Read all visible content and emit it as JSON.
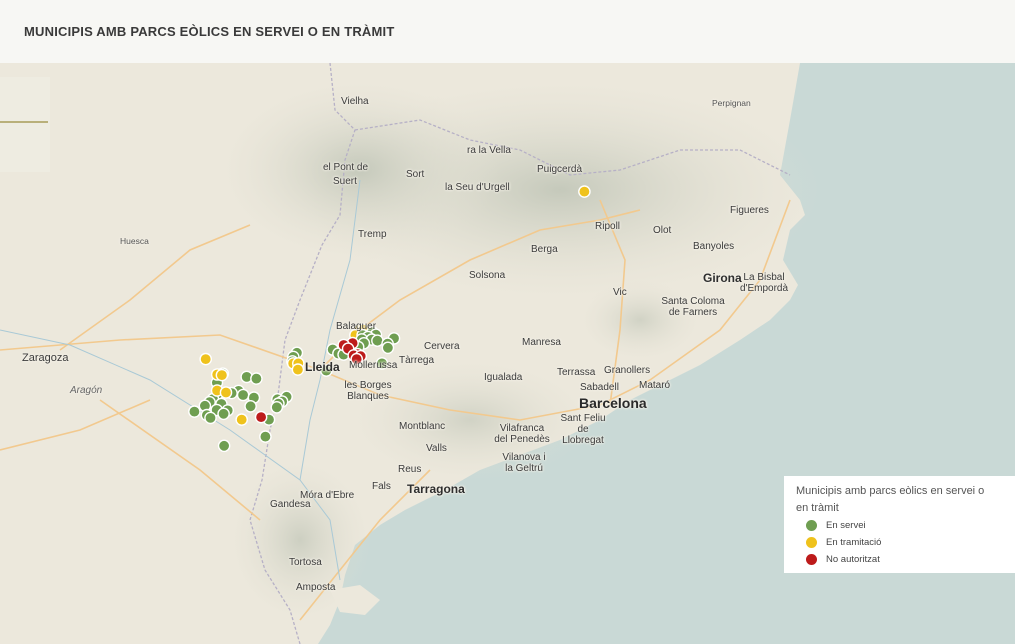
{
  "header": {
    "title": "MUNICIPIS AMB PARCS EÒLICS EN SERVEI O EN TRÀMIT"
  },
  "colors": {
    "sea": "#c9d9d6",
    "land": "#ece8dc",
    "mountains": "#d8d8cb",
    "mountains_high": "#c8cbbd",
    "in_service": "#6f9e51",
    "in_process": "#efc21c",
    "not_authorized": "#bd1b1b",
    "road": "#f2c98e",
    "border": "#b6b0c6"
  },
  "legend": {
    "title": "Municipis amb parcs eòlics en servei o en tràmit",
    "items": [
      {
        "label": "En servei",
        "color": "#6f9e51"
      },
      {
        "label": "En tramitació",
        "color": "#efc21c"
      },
      {
        "label": "No autoritzat",
        "color": "#bd1b1b"
      }
    ]
  },
  "places": {
    "vielha": "Vielha",
    "perpignan": "Perpignan",
    "vall": "ra la Vella",
    "pont_de": "el Pont de",
    "suert": "Suert",
    "sort": "Sort",
    "seu": "la Seu d'Urgell",
    "puigcerda": "Puigcerdà",
    "figueres": "Figueres",
    "huesca": "Huesca",
    "tremp": "Tremp",
    "ripoll": "Ripoll",
    "olot": "Olot",
    "banyoles": "Banyoles",
    "berga": "Berga",
    "solsona": "Solsona",
    "girona": "Girona",
    "bisbal": "La Bisbal d'Empordà",
    "vic": "Vic",
    "santa_coloma": "Santa Coloma de Farners",
    "balaguer": "Balaguer",
    "cervera": "Cervera",
    "manresa": "Manresa",
    "zaragoza": "Zaragoza",
    "lleida": "Lleida",
    "mollerussa": "Mollerussa",
    "tarrega": "Tàrrega",
    "igualada": "Igualada",
    "terrassa": "Terrassa",
    "granollers": "Granollers",
    "borges": "les Borges Blanques",
    "sabadell": "Sabadell",
    "mataro": "Mataró",
    "aragon": "Aragón",
    "barcelona": "Barcelona",
    "montblanc": "Montblanc",
    "sant_feliu": "Sant Feliu de Llobregat",
    "vilafranca": "Vilafranca del Penedès",
    "valls": "Valls",
    "vilanova": "Vilanova i la Geltrú",
    "reus": "Reus",
    "tarragona": "Tarragona",
    "falset": "Fals",
    "mora": "Móra d'Ebre",
    "gandesa": "Gandesa",
    "tortosa": "Tortosa",
    "amposta": "Amposta"
  },
  "markers": [
    {
      "status": "in_process",
      "lon": 2.74,
      "lat": 42.37
    },
    {
      "status": "in_process",
      "lon": 1.294,
      "lat": 41.695
    },
    {
      "status": "in_process",
      "lon": 1.322,
      "lat": 41.697
    },
    {
      "status": "in_process",
      "lon": 1.272,
      "lat": 41.67
    },
    {
      "status": "in_service",
      "lon": 1.381,
      "lat": 41.684
    },
    {
      "status": "in_service",
      "lon": 1.318,
      "lat": 41.67
    },
    {
      "status": "in_service",
      "lon": 1.403,
      "lat": 41.672
    },
    {
      "status": "in_service",
      "lon": 1.353,
      "lat": 41.661
    },
    {
      "status": "in_service",
      "lon": 1.313,
      "lat": 41.649
    },
    {
      "status": "in_service",
      "lon": 1.377,
      "lat": 41.648
    },
    {
      "status": "in_service",
      "lon": 1.413,
      "lat": 41.643
    },
    {
      "status": "in_service",
      "lon": 1.519,
      "lat": 41.654
    },
    {
      "status": "in_service",
      "lon": 1.478,
      "lat": 41.628
    },
    {
      "status": "in_service",
      "lon": 1.326,
      "lat": 41.63
    },
    {
      "status": "in_service",
      "lon": 1.29,
      "lat": 41.612
    },
    {
      "status": "in_service",
      "lon": 1.48,
      "lat": 41.608
    },
    {
      "status": "in_service",
      "lon": 1.234,
      "lat": 41.601
    },
    {
      "status": "in_service",
      "lon": 1.186,
      "lat": 41.599
    },
    {
      "status": "in_service",
      "lon": 1.126,
      "lat": 41.6
    },
    {
      "status": "in_service",
      "lon": 1.208,
      "lat": 41.587
    },
    {
      "status": "in_service",
      "lon": 1.163,
      "lat": 41.58
    },
    {
      "status": "in_service",
      "lon": 1.196,
      "lat": 41.575
    },
    {
      "status": "in_service",
      "lon": 0.897,
      "lat": 41.584
    },
    {
      "status": "in_service",
      "lon": 0.874,
      "lat": 41.564
    },
    {
      "status": "in_service",
      "lon": 0.868,
      "lat": 41.542
    },
    {
      "status": "in_service",
      "lon": 1.442,
      "lat": 41.532
    },
    {
      "status": "in_service",
      "lon": 1.085,
      "lat": 41.497
    },
    {
      "status": "in_service",
      "lon": 0.422,
      "lat": 41.482
    },
    {
      "status": "in_service",
      "lon": 0.575,
      "lat": 41.466
    },
    {
      "status": "in_service",
      "lon": 0.637,
      "lat": 41.458
    },
    {
      "status": "in_service",
      "lon": 0.384,
      "lat": 41.438
    },
    {
      "status": "in_service",
      "lon": 0.523,
      "lat": 41.398
    },
    {
      "status": "in_service",
      "lon": 0.478,
      "lat": 41.387
    },
    {
      "status": "in_service",
      "lon": 0.393,
      "lat": 41.386
    },
    {
      "status": "in_service",
      "lon": 0.831,
      "lat": 41.369
    },
    {
      "status": "in_service",
      "lon": 0.552,
      "lat": 41.378
    },
    {
      "status": "in_service",
      "lon": 0.621,
      "lat": 41.365
    },
    {
      "status": "in_service",
      "lon": 0.359,
      "lat": 41.358
    },
    {
      "status": "in_service",
      "lon": 0.772,
      "lat": 41.357
    },
    {
      "status": "in_service",
      "lon": 0.802,
      "lat": 41.346
    },
    {
      "status": "in_service",
      "lon": 0.337,
      "lat": 41.343
    },
    {
      "status": "in_service",
      "lon": 0.778,
      "lat": 41.336
    },
    {
      "status": "in_service",
      "lon": 0.413,
      "lat": 41.334
    },
    {
      "status": "in_service",
      "lon": 0.768,
      "lat": 41.318
    },
    {
      "status": "in_service",
      "lon": 0.307,
      "lat": 41.325
    },
    {
      "status": "in_service",
      "lon": 0.6,
      "lat": 41.323
    },
    {
      "status": "in_service",
      "lon": 0.383,
      "lat": 41.305
    },
    {
      "status": "in_service",
      "lon": 0.453,
      "lat": 41.303
    },
    {
      "status": "in_service",
      "lon": 0.24,
      "lat": 41.297
    },
    {
      "status": "in_service",
      "lon": 0.427,
      "lat": 41.286
    },
    {
      "status": "in_service",
      "lon": 0.32,
      "lat": 41.28
    },
    {
      "status": "in_service",
      "lon": 0.343,
      "lat": 41.266
    },
    {
      "status": "in_service",
      "lon": 0.718,
      "lat": 41.258
    },
    {
      "status": "in_service",
      "lon": 0.695,
      "lat": 41.175
    },
    {
      "status": "in_service",
      "lon": 0.43,
      "lat": 41.13
    },
    {
      "status": "in_process",
      "lon": 0.386,
      "lat": 41.478
    },
    {
      "status": "in_process",
      "lon": 0.873,
      "lat": 41.532
    },
    {
      "status": "in_process",
      "lon": 0.906,
      "lat": 41.532
    },
    {
      "status": "in_process",
      "lon": 0.416,
      "lat": 41.475
    },
    {
      "status": "in_process",
      "lon": 0.385,
      "lat": 41.4
    },
    {
      "status": "in_process",
      "lon": 0.442,
      "lat": 41.39
    },
    {
      "status": "in_process",
      "lon": 0.903,
      "lat": 41.502
    },
    {
      "status": "in_process",
      "lon": 0.312,
      "lat": 41.553
    },
    {
      "status": "in_process",
      "lon": 0.543,
      "lat": 41.258
    },
    {
      "status": "not_authorized",
      "lon": 1.254,
      "lat": 41.631
    },
    {
      "status": "not_authorized",
      "lon": 1.197,
      "lat": 41.622
    },
    {
      "status": "not_authorized",
      "lon": 1.225,
      "lat": 41.604
    },
    {
      "status": "not_authorized",
      "lon": 1.286,
      "lat": 41.577
    },
    {
      "status": "not_authorized",
      "lon": 1.261,
      "lat": 41.571
    },
    {
      "status": "not_authorized",
      "lon": 1.306,
      "lat": 41.567
    },
    {
      "status": "not_authorized",
      "lon": 1.28,
      "lat": 41.553
    },
    {
      "status": "not_authorized",
      "lon": 0.667,
      "lat": 41.27
    }
  ]
}
